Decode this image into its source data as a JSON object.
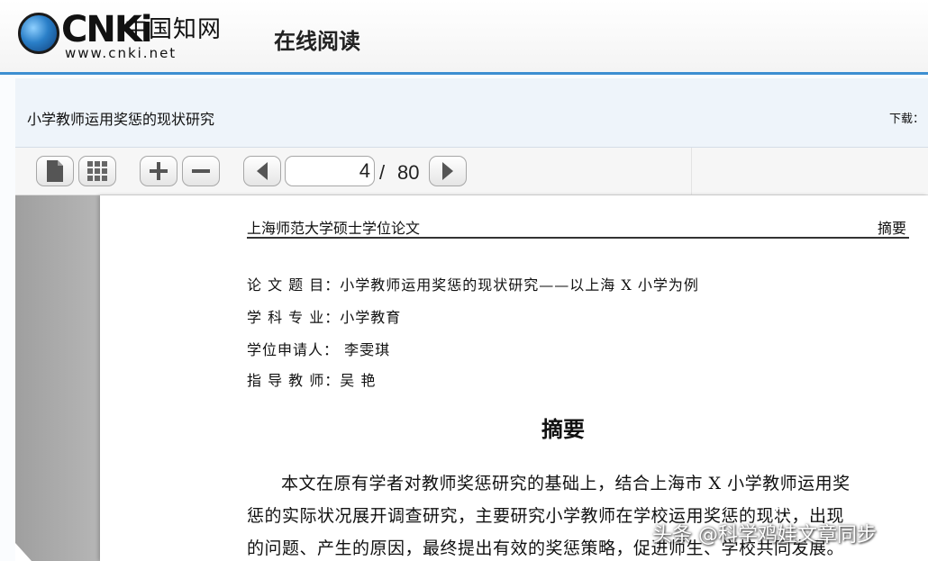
{
  "brand": {
    "logo_mark": "CNKi",
    "logo_cn": "中国知网",
    "logo_url": "www.cnki.net",
    "app_title": "在线阅读"
  },
  "document": {
    "title": "小学教师运用奖惩的现状研究",
    "download_label": "下载："
  },
  "toolbar": {
    "current_page": "4",
    "page_separator": "/",
    "total_pages": "80"
  },
  "page": {
    "running_head_left": "上海师范大学硕士学位论文",
    "running_head_right": "摘要",
    "meta": [
      {
        "label": "论 文 题 目：",
        "value": "小学教师运用奖惩的现状研究——以上海 X 小学为例"
      },
      {
        "label": "学 科 专 业：",
        "value": "小学教育"
      },
      {
        "label": "学位申请人：",
        "value": " 李雯琪"
      },
      {
        "label": "指 导 教 师：",
        "value": "吴  艳"
      }
    ],
    "abstract_title": "摘要",
    "abstract_lines": [
      "本文在原有学者对教师奖惩研究的基础上，结合上海市 X 小学教师运用奖",
      "惩的实际状况展开调查研究，主要研究小学教师在学校运用奖惩的现状，出现",
      "的问题、产生的原因，最终提出有效的奖惩策略，促进师生、学校共同发展。"
    ]
  },
  "watermark": "头条 @科学鸡娃文章同步"
}
